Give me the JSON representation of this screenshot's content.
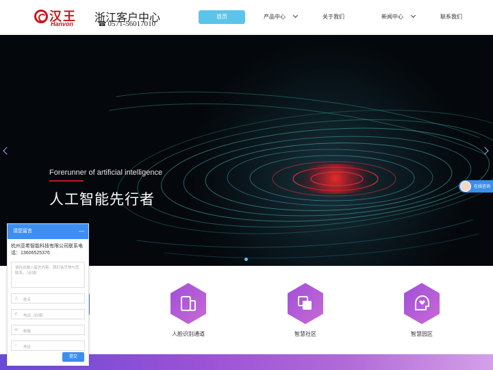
{
  "header": {
    "logo_cn": "汉王",
    "logo_en": "Hanvon",
    "center_title": "浙江客户中心",
    "center_phone_icon": "☎",
    "center_phone": "0571-56017010"
  },
  "nav": {
    "items": [
      {
        "label": "首页",
        "active": true
      },
      {
        "label": "产品中心",
        "dropdown": true
      },
      {
        "label": "关于我们"
      },
      {
        "label": "新闻中心",
        "dropdown": true
      },
      {
        "label": "联系我们"
      }
    ]
  },
  "banner": {
    "subtitle": "Forerunner of artificial intelligence",
    "title": "人工智能先行者",
    "accent_color": "#c8161d"
  },
  "consult": {
    "label": "在线咨询"
  },
  "services": [
    {
      "label": "人脸识别通道",
      "icon": "device-icon"
    },
    {
      "label": "智慧社区",
      "icon": "layers-icon"
    },
    {
      "label": "智慧园区",
      "icon": "heart-head-icon"
    }
  ],
  "message_panel": {
    "title": "请您留言",
    "minimize": "—",
    "company_info": "杭州亚希智能科技有限公司联系电话：13606525376",
    "textarea_placeholder": "请在此输入留言内容，我们会尽快与您联系。（必填）",
    "fields": [
      {
        "icon": "person-icon",
        "placeholder": "姓名"
      },
      {
        "icon": "phone-icon",
        "placeholder": "电话（必填）"
      },
      {
        "icon": "mail-icon",
        "placeholder": "邮箱"
      },
      {
        "icon": "location-icon",
        "placeholder": "地址"
      }
    ],
    "submit_label": "提交"
  }
}
